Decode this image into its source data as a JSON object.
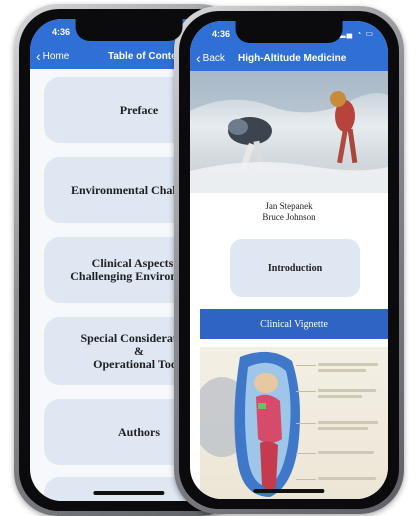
{
  "colors": {
    "accent": "#2f6fd6",
    "toc_button_bg": "#dfe7f3",
    "vignette_bg": "#2f63c4"
  },
  "toc_screen": {
    "status_time": "4:36",
    "back_label": "Home",
    "title": "Table of Contents",
    "items": [
      {
        "label": "Preface"
      },
      {
        "label": "Environmental Challenges"
      },
      {
        "label": "Clinical Aspects of\nChallenging Environments"
      },
      {
        "label": "Special Considerations\n&\nOperational Tools"
      },
      {
        "label": "Authors"
      }
    ]
  },
  "chapter_screen": {
    "status_time": "4:36",
    "back_label": "Back",
    "title": "High-Altitude Medicine",
    "authors": [
      "Jan Stepanek",
      "Bruce Johnson"
    ],
    "intro_label": "Introduction",
    "vignette_label": "Clinical Vignette"
  }
}
